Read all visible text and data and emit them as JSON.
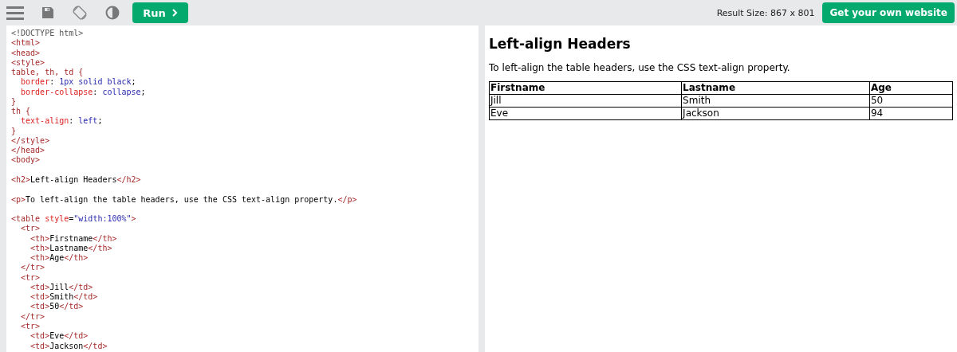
{
  "toolbar": {
    "run_button": "Run",
    "result_size": "Result Size: 867 x 801",
    "cta_button": "Get your own website"
  },
  "code_lines": [
    {
      "kind": "code",
      "tokens": [
        {
          "kind": "doctype",
          "t": "<!DOCTYPE html>"
        }
      ]
    },
    {
      "kind": "code",
      "tokens": [
        {
          "kind": "tag",
          "t": "<html>"
        }
      ]
    },
    {
      "kind": "code",
      "tokens": [
        {
          "kind": "tag",
          "t": "<head>"
        }
      ]
    },
    {
      "kind": "code",
      "tokens": [
        {
          "kind": "tag",
          "t": "<style>"
        }
      ]
    },
    {
      "kind": "code",
      "tokens": [
        {
          "kind": "sel",
          "t": "table, th, td {"
        }
      ]
    },
    {
      "kind": "code",
      "tokens": [
        {
          "kind": "prop",
          "t": "  border"
        },
        {
          "kind": "text",
          "t": ": "
        },
        {
          "kind": "value",
          "t": "1px solid black"
        },
        {
          "kind": "text",
          "t": ";"
        }
      ]
    },
    {
      "kind": "code",
      "tokens": [
        {
          "kind": "prop",
          "t": "  border-collapse"
        },
        {
          "kind": "text",
          "t": ": "
        },
        {
          "kind": "value",
          "t": "collapse"
        },
        {
          "kind": "text",
          "t": ";"
        }
      ]
    },
    {
      "kind": "code",
      "tokens": [
        {
          "kind": "sel",
          "t": "}"
        }
      ]
    },
    {
      "kind": "code",
      "tokens": [
        {
          "kind": "sel",
          "t": "th {"
        }
      ]
    },
    {
      "kind": "code",
      "tokens": [
        {
          "kind": "prop",
          "t": "  text-align"
        },
        {
          "kind": "text",
          "t": ": "
        },
        {
          "kind": "value",
          "t": "left"
        },
        {
          "kind": "text",
          "t": ";"
        }
      ]
    },
    {
      "kind": "code",
      "tokens": [
        {
          "kind": "sel",
          "t": "}"
        }
      ]
    },
    {
      "kind": "code",
      "tokens": [
        {
          "kind": "tag",
          "t": "</style>"
        }
      ]
    },
    {
      "kind": "code",
      "tokens": [
        {
          "kind": "tag",
          "t": "</head>"
        }
      ]
    },
    {
      "kind": "code",
      "tokens": [
        {
          "kind": "tag",
          "t": "<body>"
        }
      ]
    },
    {
      "kind": "blank"
    },
    {
      "kind": "code",
      "tokens": [
        {
          "kind": "tag",
          "t": "<h2>"
        },
        {
          "kind": "text",
          "t": "Left-align Headers"
        },
        {
          "kind": "tag",
          "t": "</h2>"
        }
      ]
    },
    {
      "kind": "blank"
    },
    {
      "kind": "code",
      "tokens": [
        {
          "kind": "tag",
          "t": "<p>"
        },
        {
          "kind": "text",
          "t": "To left-align the table headers, use the CSS text-align property."
        },
        {
          "kind": "tag",
          "t": "</p>"
        }
      ]
    },
    {
      "kind": "blank"
    },
    {
      "kind": "code",
      "tokens": [
        {
          "kind": "tag",
          "t": "<table "
        },
        {
          "kind": "attr",
          "t": "style"
        },
        {
          "kind": "text",
          "t": "="
        },
        {
          "kind": "value",
          "t": "\"width:100%\""
        },
        {
          "kind": "tag",
          "t": ">"
        }
      ]
    },
    {
      "kind": "code",
      "tokens": [
        {
          "kind": "tag",
          "t": "  <tr>"
        }
      ]
    },
    {
      "kind": "code",
      "tokens": [
        {
          "kind": "tag",
          "t": "    <th>"
        },
        {
          "kind": "text",
          "t": "Firstname"
        },
        {
          "kind": "tag",
          "t": "</th>"
        }
      ]
    },
    {
      "kind": "code",
      "tokens": [
        {
          "kind": "tag",
          "t": "    <th>"
        },
        {
          "kind": "text",
          "t": "Lastname"
        },
        {
          "kind": "tag",
          "t": "</th>"
        }
      ]
    },
    {
      "kind": "code",
      "tokens": [
        {
          "kind": "tag",
          "t": "    <th>"
        },
        {
          "kind": "text",
          "t": "Age"
        },
        {
          "kind": "tag",
          "t": "</th>"
        }
      ]
    },
    {
      "kind": "code",
      "tokens": [
        {
          "kind": "tag",
          "t": "  </tr>"
        }
      ]
    },
    {
      "kind": "code",
      "tokens": [
        {
          "kind": "tag",
          "t": "  <tr>"
        }
      ]
    },
    {
      "kind": "code",
      "tokens": [
        {
          "kind": "tag",
          "t": "    <td>"
        },
        {
          "kind": "text",
          "t": "Jill"
        },
        {
          "kind": "tag",
          "t": "</td>"
        }
      ]
    },
    {
      "kind": "code",
      "tokens": [
        {
          "kind": "tag",
          "t": "    <td>"
        },
        {
          "kind": "text",
          "t": "Smith"
        },
        {
          "kind": "tag",
          "t": "</td>"
        }
      ]
    },
    {
      "kind": "code",
      "tokens": [
        {
          "kind": "tag",
          "t": "    <td>"
        },
        {
          "kind": "text",
          "t": "50"
        },
        {
          "kind": "tag",
          "t": "</td>"
        }
      ]
    },
    {
      "kind": "code",
      "tokens": [
        {
          "kind": "tag",
          "t": "  </tr>"
        }
      ]
    },
    {
      "kind": "code",
      "tokens": [
        {
          "kind": "tag",
          "t": "  <tr>"
        }
      ]
    },
    {
      "kind": "code",
      "tokens": [
        {
          "kind": "tag",
          "t": "    <td>"
        },
        {
          "kind": "text",
          "t": "Eve"
        },
        {
          "kind": "tag",
          "t": "</td>"
        }
      ]
    },
    {
      "kind": "code",
      "tokens": [
        {
          "kind": "tag",
          "t": "    <td>"
        },
        {
          "kind": "text",
          "t": "Jackson"
        },
        {
          "kind": "tag",
          "t": "</td>"
        }
      ]
    }
  ],
  "result": {
    "heading": "Left-align Headers",
    "paragraph": "To left-align the table headers, use the CSS text-align property.",
    "table": {
      "columns": [
        "Firstname",
        "Lastname",
        "Age"
      ],
      "rows": [
        [
          "Jill",
          "Smith",
          "50"
        ],
        [
          "Eve",
          "Jackson",
          "94"
        ]
      ]
    }
  }
}
